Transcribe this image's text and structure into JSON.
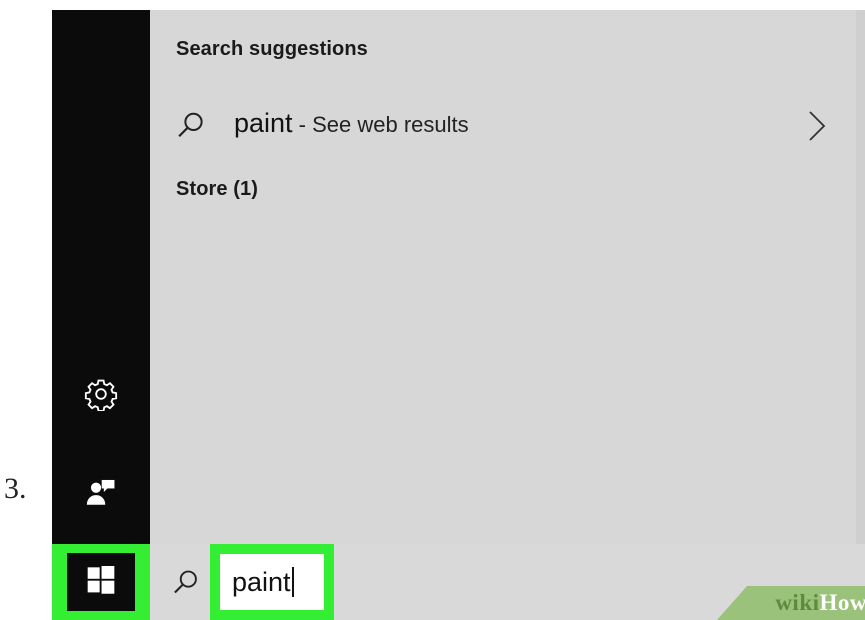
{
  "step": {
    "number": "3."
  },
  "suggestions": {
    "heading": "Search suggestions",
    "items": [
      {
        "query": "paint",
        "suffix": " - See web results",
        "icon": "search-icon",
        "action_icon": "chevron-right-icon"
      }
    ]
  },
  "store": {
    "heading": "Store (1)"
  },
  "rail": {
    "settings_icon": "gear-icon",
    "account_icon": "user-account-icon"
  },
  "taskbar": {
    "start_icon": "windows-logo-icon",
    "search_icon": "search-icon",
    "search_value": "paint"
  },
  "watermark": {
    "wiki": "wiki",
    "how": "How"
  },
  "colors": {
    "highlight": "#33ee33",
    "rail": "#0b0b0b",
    "panel": "#d7d7d7"
  }
}
